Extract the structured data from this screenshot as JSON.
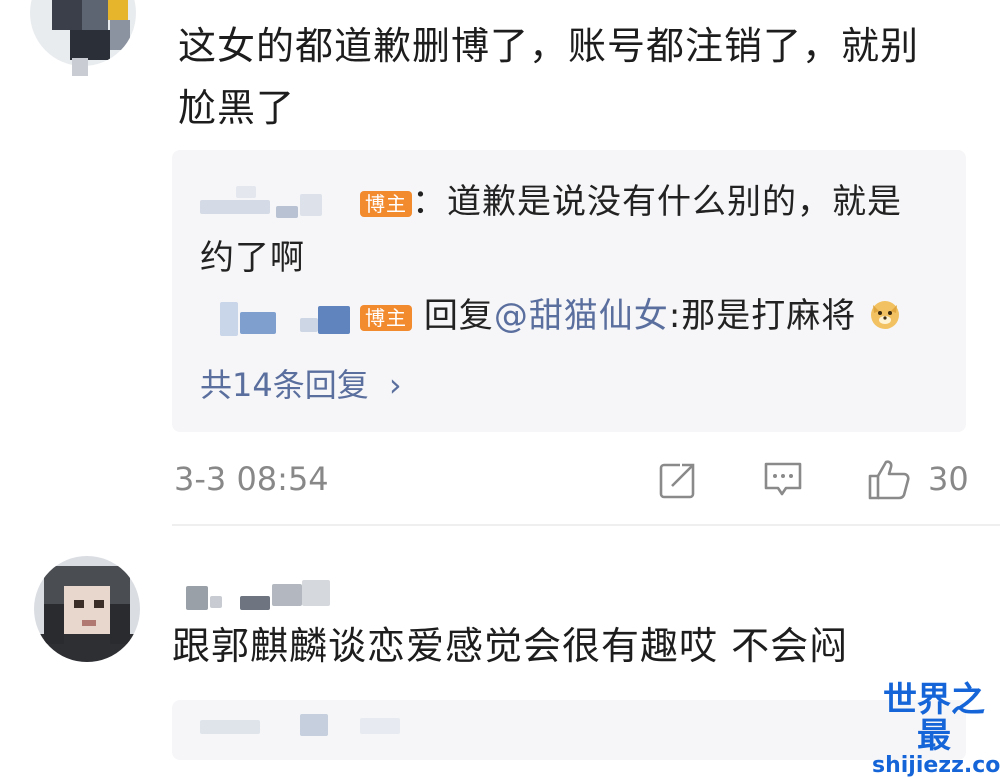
{
  "comments": [
    {
      "text_line1": "这女的都道歉删博了，账号都注销了，就别",
      "text_line2": "尬黑了",
      "replies": [
        {
          "badge": "博主",
          "text_a": "：道歉是说没有什么别的，就是",
          "text_b": "约了啊"
        },
        {
          "badge": "博主",
          "prefix": "回复",
          "mention": "@甜猫仙女",
          "text": ":那是打麻将"
        }
      ],
      "more_replies": "共14条回复",
      "more_chevron": "›",
      "timestamp": "3-3 08:54",
      "like_count": "30"
    },
    {
      "text": "跟郭麒麟谈恋爱感觉会很有趣哎 不会闷"
    }
  ],
  "watermark": {
    "title": "世界之最",
    "url": "shijiezz.com"
  },
  "colors": {
    "badge": "#f28a2e",
    "link": "#5b6f9e",
    "watermark": "#1565d8"
  }
}
